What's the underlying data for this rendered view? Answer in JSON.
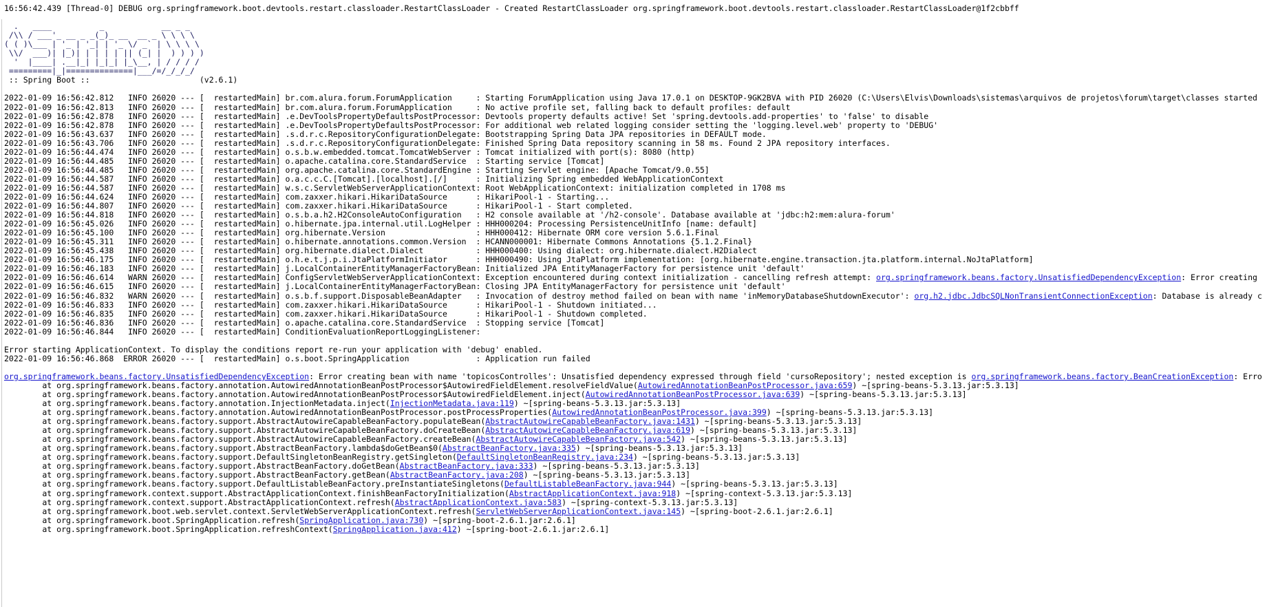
{
  "window": {
    "type": "console-log-output",
    "app": "Spring Boot application console",
    "background_color": "#ffffff",
    "text_color": "#000000",
    "link_color": "#1414cc",
    "banner_color": "#1a1a5e"
  },
  "debug_line": "16:56:42.439 [Thread-0] DEBUG org.springframework.boot.devtools.restart.classloader.RestartClassLoader - Created RestartClassLoader org.springframework.boot.devtools.restart.classloader.RestartClassLoader@1f2cbbff",
  "banner": {
    "art": [
      "  .   ____          _            __ _ _",
      " /\\\\ / ___'_ __ _ _(_)_ __  __ _ \\ \\ \\ \\",
      "( ( )\\___ | '_ | '_| | '_ \\/ _` | \\ \\ \\ \\",
      " \\\\/  ___)| |_)| | | | | || (_| |  ) ) ) )",
      "  '  |____| .__|_| |_|_| |_\\__, | / / / /",
      " =========|_|==============|___/=/_/_/_/"
    ],
    "title": " :: Spring Boot :: ",
    "version": "(v2.6.1)",
    "version_pad": 22
  },
  "log": {
    "date": "2022-01-09",
    "pid": "26020",
    "thread": "restartedMain",
    "separator": "---",
    "lines": [
      {
        "time": "16:56:42.812",
        "level": "INFO",
        "logger": "br.com.alura.forum.ForumApplication",
        "message": "Starting ForumApplication using Java 17.0.1 on DESKTOP-9GK2BVA with PID 26020 (C:\\Users\\Elvis\\Downloads\\sistemas\\arquivos de projetos\\forum\\target\\classes started "
      },
      {
        "time": "16:56:42.813",
        "level": "INFO",
        "logger": "br.com.alura.forum.ForumApplication",
        "message": "No active profile set, falling back to default profiles: default"
      },
      {
        "time": "16:56:42.878",
        "level": "INFO",
        "logger": ".e.DevToolsPropertyDefaultsPostProcessor",
        "message": "Devtools property defaults active! Set 'spring.devtools.add-properties' to 'false' to disable"
      },
      {
        "time": "16:56:42.878",
        "level": "INFO",
        "logger": ".e.DevToolsPropertyDefaultsPostProcessor",
        "message": "For additional web related logging consider setting the 'logging.level.web' property to 'DEBUG'"
      },
      {
        "time": "16:56:43.637",
        "level": "INFO",
        "logger": ".s.d.r.c.RepositoryConfigurationDelegate",
        "message": "Bootstrapping Spring Data JPA repositories in DEFAULT mode."
      },
      {
        "time": "16:56:43.706",
        "level": "INFO",
        "logger": ".s.d.r.c.RepositoryConfigurationDelegate",
        "message": "Finished Spring Data repository scanning in 58 ms. Found 2 JPA repository interfaces."
      },
      {
        "time": "16:56:44.474",
        "level": "INFO",
        "logger": "o.s.b.w.embedded.tomcat.TomcatWebServer",
        "message": "Tomcat initialized with port(s): 8080 (http)"
      },
      {
        "time": "16:56:44.485",
        "level": "INFO",
        "logger": "o.apache.catalina.core.StandardService",
        "message": "Starting service [Tomcat]"
      },
      {
        "time": "16:56:44.485",
        "level": "INFO",
        "logger": "org.apache.catalina.core.StandardEngine",
        "message": "Starting Servlet engine: [Apache Tomcat/9.0.55]"
      },
      {
        "time": "16:56:44.587",
        "level": "INFO",
        "logger": "o.a.c.c.C.[Tomcat].[localhost].[/]",
        "message": "Initializing Spring embedded WebApplicationContext"
      },
      {
        "time": "16:56:44.587",
        "level": "INFO",
        "logger": "w.s.c.ServletWebServerApplicationContext",
        "message": "Root WebApplicationContext: initialization completed in 1708 ms"
      },
      {
        "time": "16:56:44.624",
        "level": "INFO",
        "logger": "com.zaxxer.hikari.HikariDataSource",
        "message": "HikariPool-1 - Starting..."
      },
      {
        "time": "16:56:44.807",
        "level": "INFO",
        "logger": "com.zaxxer.hikari.HikariDataSource",
        "message": "HikariPool-1 - Start completed."
      },
      {
        "time": "16:56:44.818",
        "level": "INFO",
        "logger": "o.s.b.a.h2.H2ConsoleAutoConfiguration",
        "message": "H2 console available at '/h2-console'. Database available at 'jdbc:h2:mem:alura-forum'"
      },
      {
        "time": "16:56:45.026",
        "level": "INFO",
        "logger": "o.hibernate.jpa.internal.util.LogHelper",
        "message": "HHH000204: Processing PersistenceUnitInfo [name: default]"
      },
      {
        "time": "16:56:45.100",
        "level": "INFO",
        "logger": "org.hibernate.Version",
        "message": "HHH000412: Hibernate ORM core version 5.6.1.Final"
      },
      {
        "time": "16:56:45.311",
        "level": "INFO",
        "logger": "o.hibernate.annotations.common.Version",
        "message": "HCANN000001: Hibernate Commons Annotations {5.1.2.Final}"
      },
      {
        "time": "16:56:45.438",
        "level": "INFO",
        "logger": "org.hibernate.dialect.Dialect",
        "message": "HHH000400: Using dialect: org.hibernate.dialect.H2Dialect"
      },
      {
        "time": "16:56:46.175",
        "level": "INFO",
        "logger": "o.h.e.t.j.p.i.JtaPlatformInitiator",
        "message": "HHH000490: Using JtaPlatform implementation: [org.hibernate.engine.transaction.jta.platform.internal.NoJtaPlatform]"
      },
      {
        "time": "16:56:46.183",
        "level": "INFO",
        "logger": "j.LocalContainerEntityManagerFactoryBean",
        "message": "Initialized JPA EntityManagerFactory for persistence unit 'default'"
      },
      {
        "time": "16:56:46.614",
        "level": "WARN",
        "logger": "ConfigServletWebServerApplicationContext",
        "message_pre": "Exception encountered during context initialization - cancelling refresh attempt: ",
        "link": "org.springframework.beans.factory.UnsatisfiedDependencyException",
        "message_post": ": Error creating "
      },
      {
        "time": "16:56:46.615",
        "level": "INFO",
        "logger": "j.LocalContainerEntityManagerFactoryBean",
        "message": "Closing JPA EntityManagerFactory for persistence unit 'default'"
      },
      {
        "time": "16:56:46.832",
        "level": "WARN",
        "logger": "o.s.b.f.support.DisposableBeanAdapter",
        "message_pre": "Invocation of destroy method failed on bean with name 'inMemoryDatabaseShutdownExecutor': ",
        "link": "org.h2.jdbc.JdbcSQLNonTransientConnectionException",
        "message_post": ": Database is already c"
      },
      {
        "time": "16:56:46.833",
        "level": "INFO",
        "logger": "com.zaxxer.hikari.HikariDataSource",
        "message": "HikariPool-1 - Shutdown initiated..."
      },
      {
        "time": "16:56:46.835",
        "level": "INFO",
        "logger": "com.zaxxer.hikari.HikariDataSource",
        "message": "HikariPool-1 - Shutdown completed."
      },
      {
        "time": "16:56:46.836",
        "level": "INFO",
        "logger": "o.apache.catalina.core.StandardService",
        "message": "Stopping service [Tomcat]"
      },
      {
        "time": "16:56:46.844",
        "level": "INFO",
        "logger": "ConditionEvaluationReportLoggingListener",
        "message": ""
      }
    ],
    "error_notice": "Error starting ApplicationContext. To display the conditions report re-run your application with 'debug' enabled.",
    "error_line": {
      "time": "16:56:46.868",
      "level": "ERROR",
      "logger": "o.s.boot.SpringApplication",
      "message": "Application run failed"
    }
  },
  "stacktrace": {
    "header": {
      "link": "org.springframework.beans.factory.UnsatisfiedDependencyException",
      "text_pre": ": Error creating bean with name 'topicosControlles': Unsatisfied dependency expressed through field 'cursoRepository'; nested exception is ",
      "link2": "org.springframework.beans.factory.BeanCreationException",
      "text_post": ": Erro"
    },
    "frames": [
      {
        "pre": "at org.springframework.beans.factory.annotation.AutowiredAnnotationBeanPostProcessor$AutowiredFieldElement.resolveFieldValue(",
        "link": "AutowiredAnnotationBeanPostProcessor.java:659",
        "post": ") ~[spring-beans-5.3.13.jar:5.3.13]"
      },
      {
        "pre": "at org.springframework.beans.factory.annotation.AutowiredAnnotationBeanPostProcessor$AutowiredFieldElement.inject(",
        "link": "AutowiredAnnotationBeanPostProcessor.java:639",
        "post": ") ~[spring-beans-5.3.13.jar:5.3.13]"
      },
      {
        "pre": "at org.springframework.beans.factory.annotation.InjectionMetadata.inject(",
        "link": "InjectionMetadata.java:119",
        "post": ") ~[spring-beans-5.3.13.jar:5.3.13]"
      },
      {
        "pre": "at org.springframework.beans.factory.annotation.AutowiredAnnotationBeanPostProcessor.postProcessProperties(",
        "link": "AutowiredAnnotationBeanPostProcessor.java:399",
        "post": ") ~[spring-beans-5.3.13.jar:5.3.13]"
      },
      {
        "pre": "at org.springframework.beans.factory.support.AbstractAutowireCapableBeanFactory.populateBean(",
        "link": "AbstractAutowireCapableBeanFactory.java:1431",
        "post": ") ~[spring-beans-5.3.13.jar:5.3.13]"
      },
      {
        "pre": "at org.springframework.beans.factory.support.AbstractAutowireCapableBeanFactory.doCreateBean(",
        "link": "AbstractAutowireCapableBeanFactory.java:619",
        "post": ") ~[spring-beans-5.3.13.jar:5.3.13]"
      },
      {
        "pre": "at org.springframework.beans.factory.support.AbstractAutowireCapableBeanFactory.createBean(",
        "link": "AbstractAutowireCapableBeanFactory.java:542",
        "post": ") ~[spring-beans-5.3.13.jar:5.3.13]"
      },
      {
        "pre": "at org.springframework.beans.factory.support.AbstractBeanFactory.lambda$doGetBean$0(",
        "link": "AbstractBeanFactory.java:335",
        "post": ") ~[spring-beans-5.3.13.jar:5.3.13]"
      },
      {
        "pre": "at org.springframework.beans.factory.support.DefaultSingletonBeanRegistry.getSingleton(",
        "link": "DefaultSingletonBeanRegistry.java:234",
        "post": ") ~[spring-beans-5.3.13.jar:5.3.13]"
      },
      {
        "pre": "at org.springframework.beans.factory.support.AbstractBeanFactory.doGetBean(",
        "link": "AbstractBeanFactory.java:333",
        "post": ") ~[spring-beans-5.3.13.jar:5.3.13]"
      },
      {
        "pre": "at org.springframework.beans.factory.support.AbstractBeanFactory.getBean(",
        "link": "AbstractBeanFactory.java:208",
        "post": ") ~[spring-beans-5.3.13.jar:5.3.13]"
      },
      {
        "pre": "at org.springframework.beans.factory.support.DefaultListableBeanFactory.preInstantiateSingletons(",
        "link": "DefaultListableBeanFactory.java:944",
        "post": ") ~[spring-beans-5.3.13.jar:5.3.13]"
      },
      {
        "pre": "at org.springframework.context.support.AbstractApplicationContext.finishBeanFactoryInitialization(",
        "link": "AbstractApplicationContext.java:918",
        "post": ") ~[spring-context-5.3.13.jar:5.3.13]"
      },
      {
        "pre": "at org.springframework.context.support.AbstractApplicationContext.refresh(",
        "link": "AbstractApplicationContext.java:583",
        "post": ") ~[spring-context-5.3.13.jar:5.3.13]"
      },
      {
        "pre": "at org.springframework.boot.web.servlet.context.ServletWebServerApplicationContext.refresh(",
        "link": "ServletWebServerApplicationContext.java:145",
        "post": ") ~[spring-boot-2.6.1.jar:2.6.1]"
      },
      {
        "pre": "at org.springframework.boot.SpringApplication.refresh(",
        "link": "SpringApplication.java:730",
        "post": ") ~[spring-boot-2.6.1.jar:2.6.1]"
      },
      {
        "pre": "at org.springframework.boot.SpringApplication.refreshContext(",
        "link": "SpringApplication.java:412",
        "post": ") ~[spring-boot-2.6.1.jar:2.6.1]"
      }
    ]
  }
}
